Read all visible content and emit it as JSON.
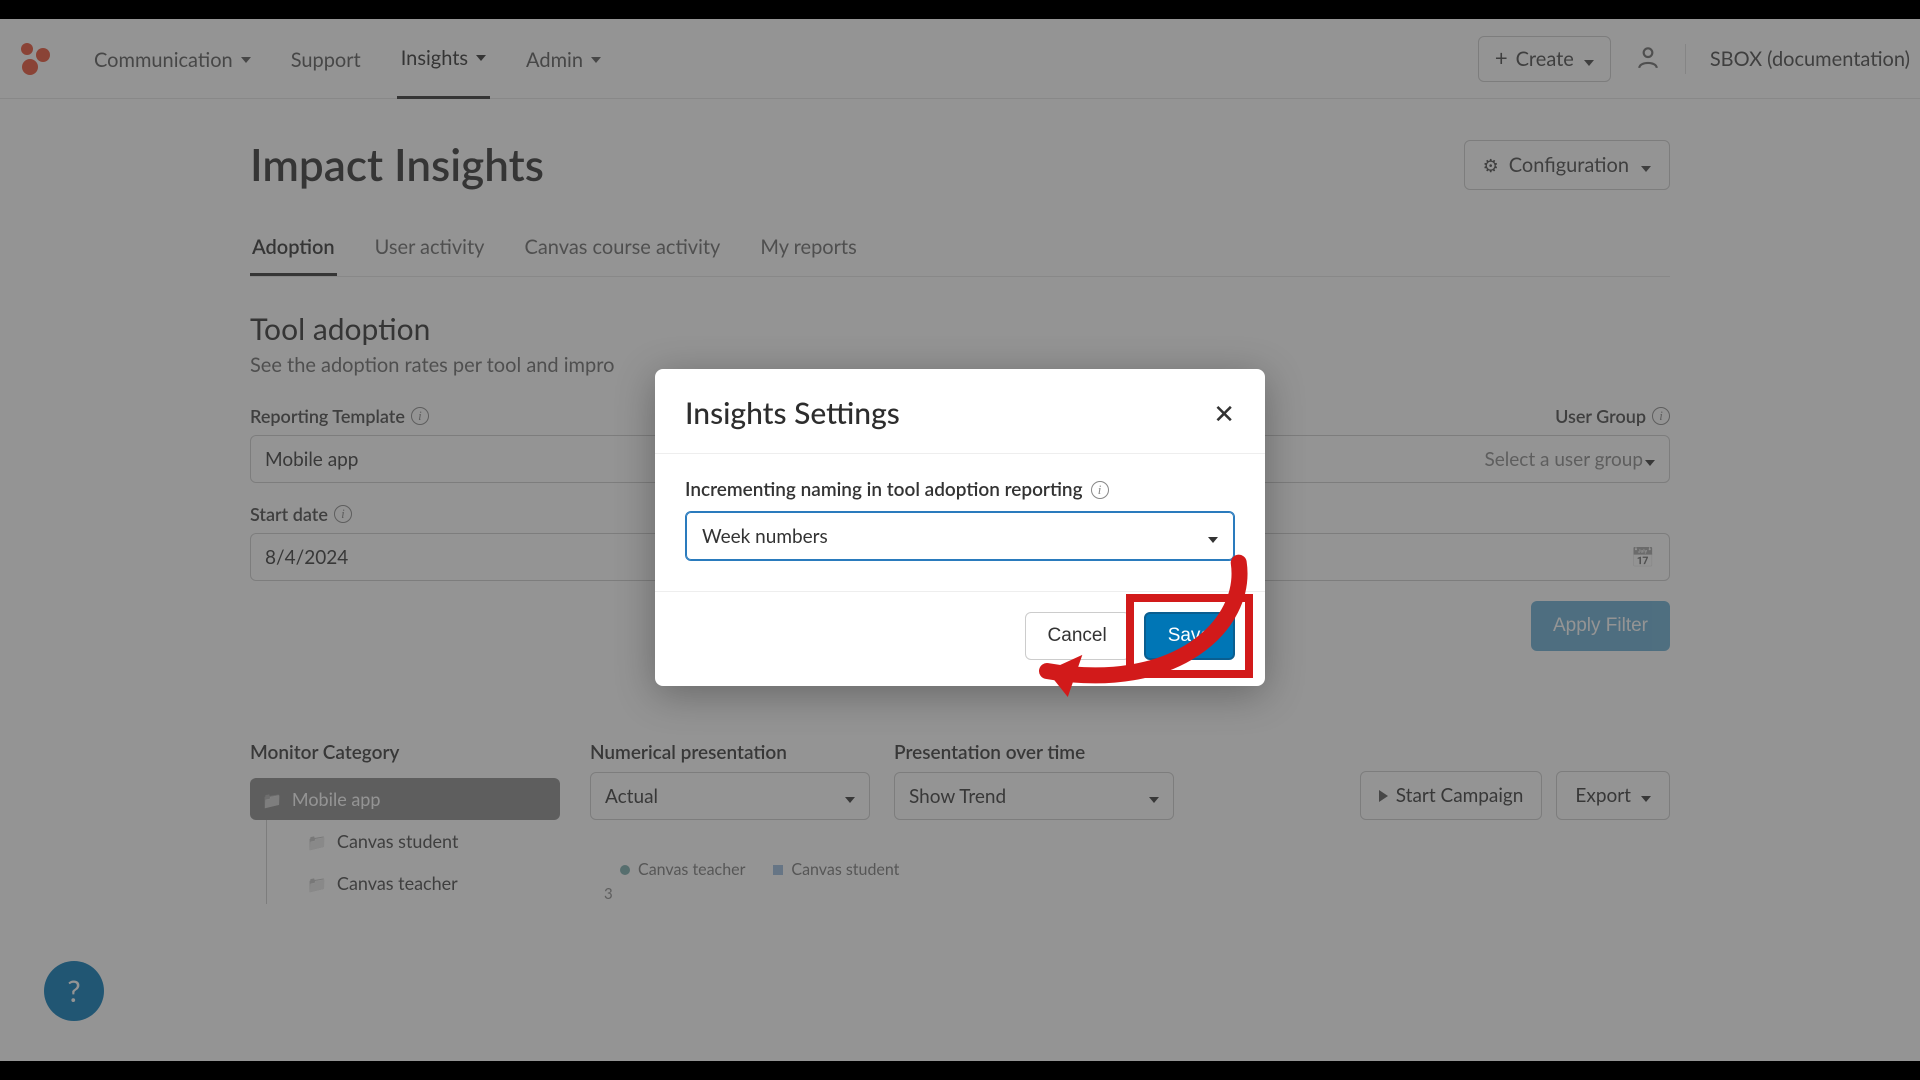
{
  "topbar": {
    "nav": {
      "communication": "Communication",
      "support": "Support",
      "insights": "Insights",
      "admin": "Admin"
    },
    "create_label": "Create",
    "org": "SBOX (documentation)"
  },
  "page": {
    "title": "Impact Insights",
    "config_label": "Configuration"
  },
  "tabs": {
    "adoption": "Adoption",
    "user_activity": "User activity",
    "canvas_course_activity": "Canvas course activity",
    "my_reports": "My reports"
  },
  "section": {
    "title": "Tool adoption",
    "sub": "See the adoption rates per tool and impro"
  },
  "filters": {
    "reporting_template": {
      "label": "Reporting Template",
      "value": "Mobile app"
    },
    "user_group": {
      "label": "User Group",
      "placeholder": "Select a user group"
    },
    "start_date": {
      "label": "Start date",
      "value": "8/4/2024"
    },
    "apply": "Apply Filter"
  },
  "tree": {
    "title": "Monitor Category",
    "items": {
      "mobile_app": "Mobile app",
      "canvas_student": "Canvas student",
      "canvas_teacher": "Canvas teacher"
    }
  },
  "chart_controls": {
    "numerical": {
      "label": "Numerical presentation",
      "value": "Actual"
    },
    "pot": {
      "label": "Presentation over time",
      "value": "Show Trend"
    },
    "campaign": "Start Campaign",
    "export": "Export"
  },
  "chart": {
    "legend": {
      "teacher": "Canvas teacher",
      "student": "Canvas student"
    },
    "y_sample": "3"
  },
  "modal": {
    "title": "Insights Settings",
    "field_label": "Incrementing naming in tool adoption reporting",
    "select_value": "Week numbers",
    "cancel": "Cancel",
    "save": "Save"
  },
  "help_fab": "?"
}
